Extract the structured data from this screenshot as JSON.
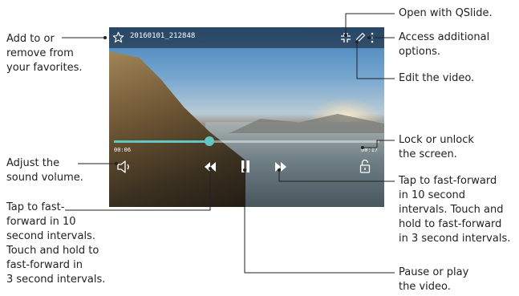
{
  "player": {
    "file_name": "20160101_212848",
    "elapsed_time": "00:06",
    "total_time": "00:17",
    "progress_fraction": 0.36,
    "accent_color": "#5ec8c4"
  },
  "callouts": {
    "favorite": "Add to or\nremove from\nyour favorites.",
    "volume": "Adjust the\nsound volume.",
    "rewind": "Tap to fast-\nforward in 10\nsecond intervals.\nTouch and hold to\nfast-forward in\n3 second intervals.",
    "qslide": "Open with QSlide.",
    "more_options": "Access additional\noptions.",
    "edit": "Edit the video.",
    "lock": "Lock or unlock\nthe screen.",
    "fast_forward": "Tap to fast-forward\nin 10 second\nintervals. Touch and\nhold to fast-forward\nin 3 second intervals.",
    "pause_play": "Pause or play\nthe video."
  },
  "icons": [
    "star-icon",
    "qslide-icon",
    "edit-pencil-icon",
    "more-options-icon",
    "volume-icon",
    "rewind-icon",
    "pause-icon",
    "fast-forward-icon",
    "lock-icon"
  ]
}
